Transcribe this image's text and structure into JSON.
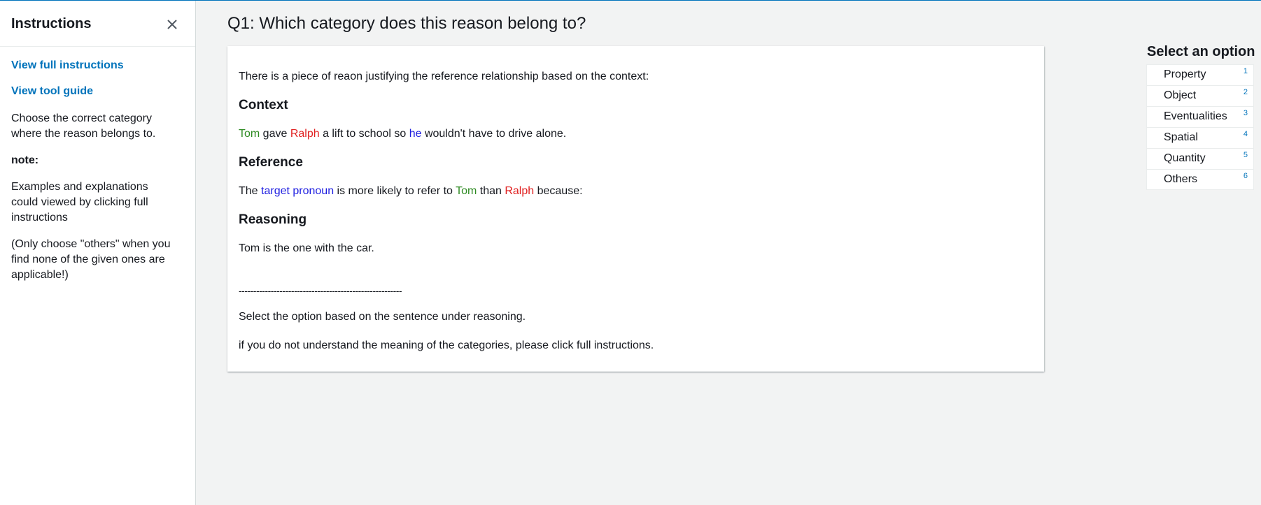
{
  "sidebar": {
    "title": "Instructions",
    "links": {
      "full_instructions": "View full instructions",
      "tool_guide": "View tool guide"
    },
    "text1": "Choose the correct category where the reason belongs to.",
    "note_label": "note:",
    "text2": "Examples and explanations could viewed by clicking full instructions",
    "text3": "(Only choose \"others\" when you find none of the given ones are applicable!)"
  },
  "question": {
    "title": "Q1: Which category does this reason belong to?"
  },
  "card": {
    "intro": "There is a piece of reaon justifying the reference relationship based on the context:",
    "context_heading": "Context",
    "context": {
      "name1": "Tom",
      "part1": " gave ",
      "name2": "Ralph",
      "part2": " a lift to school so ",
      "pronoun": "he",
      "part3": " wouldn't have to drive alone."
    },
    "reference_heading": "Reference",
    "reference": {
      "part1": "The ",
      "target": "target pronoun",
      "part2": " is more likely to refer to ",
      "name1": "Tom",
      "part3": " than ",
      "name2": "Ralph",
      "part4": " because:"
    },
    "reasoning_heading": "Reasoning",
    "reasoning": "Tom is the one with the car.",
    "divider": "--------------------------------------------------------",
    "select_text": "Select the option based on the sentence under reasoning.",
    "help_text": "if you do not understand the meaning of the categories, please click full instructions."
  },
  "options": {
    "title": "Select an option",
    "items": [
      {
        "label": "Property",
        "key": "1"
      },
      {
        "label": "Object",
        "key": "2"
      },
      {
        "label": "Eventualities",
        "key": "3"
      },
      {
        "label": "Spatial",
        "key": "4"
      },
      {
        "label": "Quantity",
        "key": "5"
      },
      {
        "label": "Others",
        "key": "6"
      }
    ]
  },
  "colors": {
    "link": "#0073bb",
    "name_green": "#2e8b22",
    "name_red": "#e02020",
    "pronoun_blue": "#1e1ee0"
  },
  "icons": {
    "close": "close-icon"
  }
}
